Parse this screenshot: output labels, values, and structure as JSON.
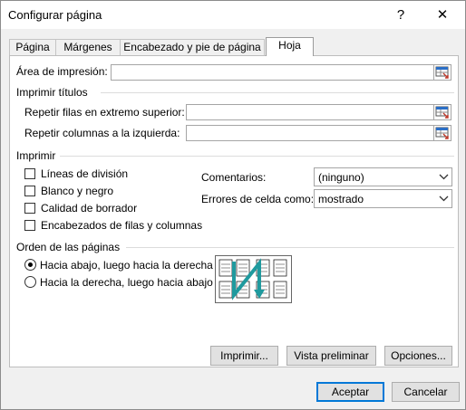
{
  "window": {
    "title": "Configurar página",
    "help_glyph": "?",
    "close_glyph": "✕"
  },
  "tabs": [
    {
      "label": "Página"
    },
    {
      "label": "Márgenes"
    },
    {
      "label": "Encabezado y pie de página"
    },
    {
      "label": "Hoja",
      "selected": true
    }
  ],
  "print_area": {
    "label": "Área de impresión:",
    "value": ""
  },
  "print_titles": {
    "section": "Imprimir títulos",
    "rows_label": "Repetir filas en extremo superior:",
    "rows_value": "",
    "cols_label": "Repetir columnas a la izquierda:",
    "cols_value": ""
  },
  "print": {
    "section": "Imprimir",
    "checkboxes": [
      {
        "label": "Líneas de división",
        "checked": false
      },
      {
        "label": "Blanco y negro",
        "checked": false
      },
      {
        "label": "Calidad de borrador",
        "checked": false
      },
      {
        "label": "Encabezados de filas y columnas",
        "checked": false
      }
    ],
    "comments_label": "Comentarios:",
    "comments_value": "(ninguno)",
    "errors_label": "Errores de celda como:",
    "errors_value": "mostrado"
  },
  "page_order": {
    "section": "Orden de las páginas",
    "options": [
      {
        "label": "Hacia abajo, luego hacia la derecha",
        "selected": true
      },
      {
        "label": "Hacia la derecha, luego hacia abajo",
        "selected": false
      }
    ]
  },
  "actions": {
    "print": "Imprimir...",
    "preview": "Vista preliminar",
    "options": "Opciones...",
    "ok": "Aceptar",
    "cancel": "Cancelar"
  },
  "colors": {
    "accent": "#0078d7",
    "diagram_arrow": "#1f9a9e"
  },
  "icons": [
    "help-icon",
    "close-icon",
    "range-picker-icon",
    "chevron-down-icon",
    "page-order-diagram-icon"
  ]
}
